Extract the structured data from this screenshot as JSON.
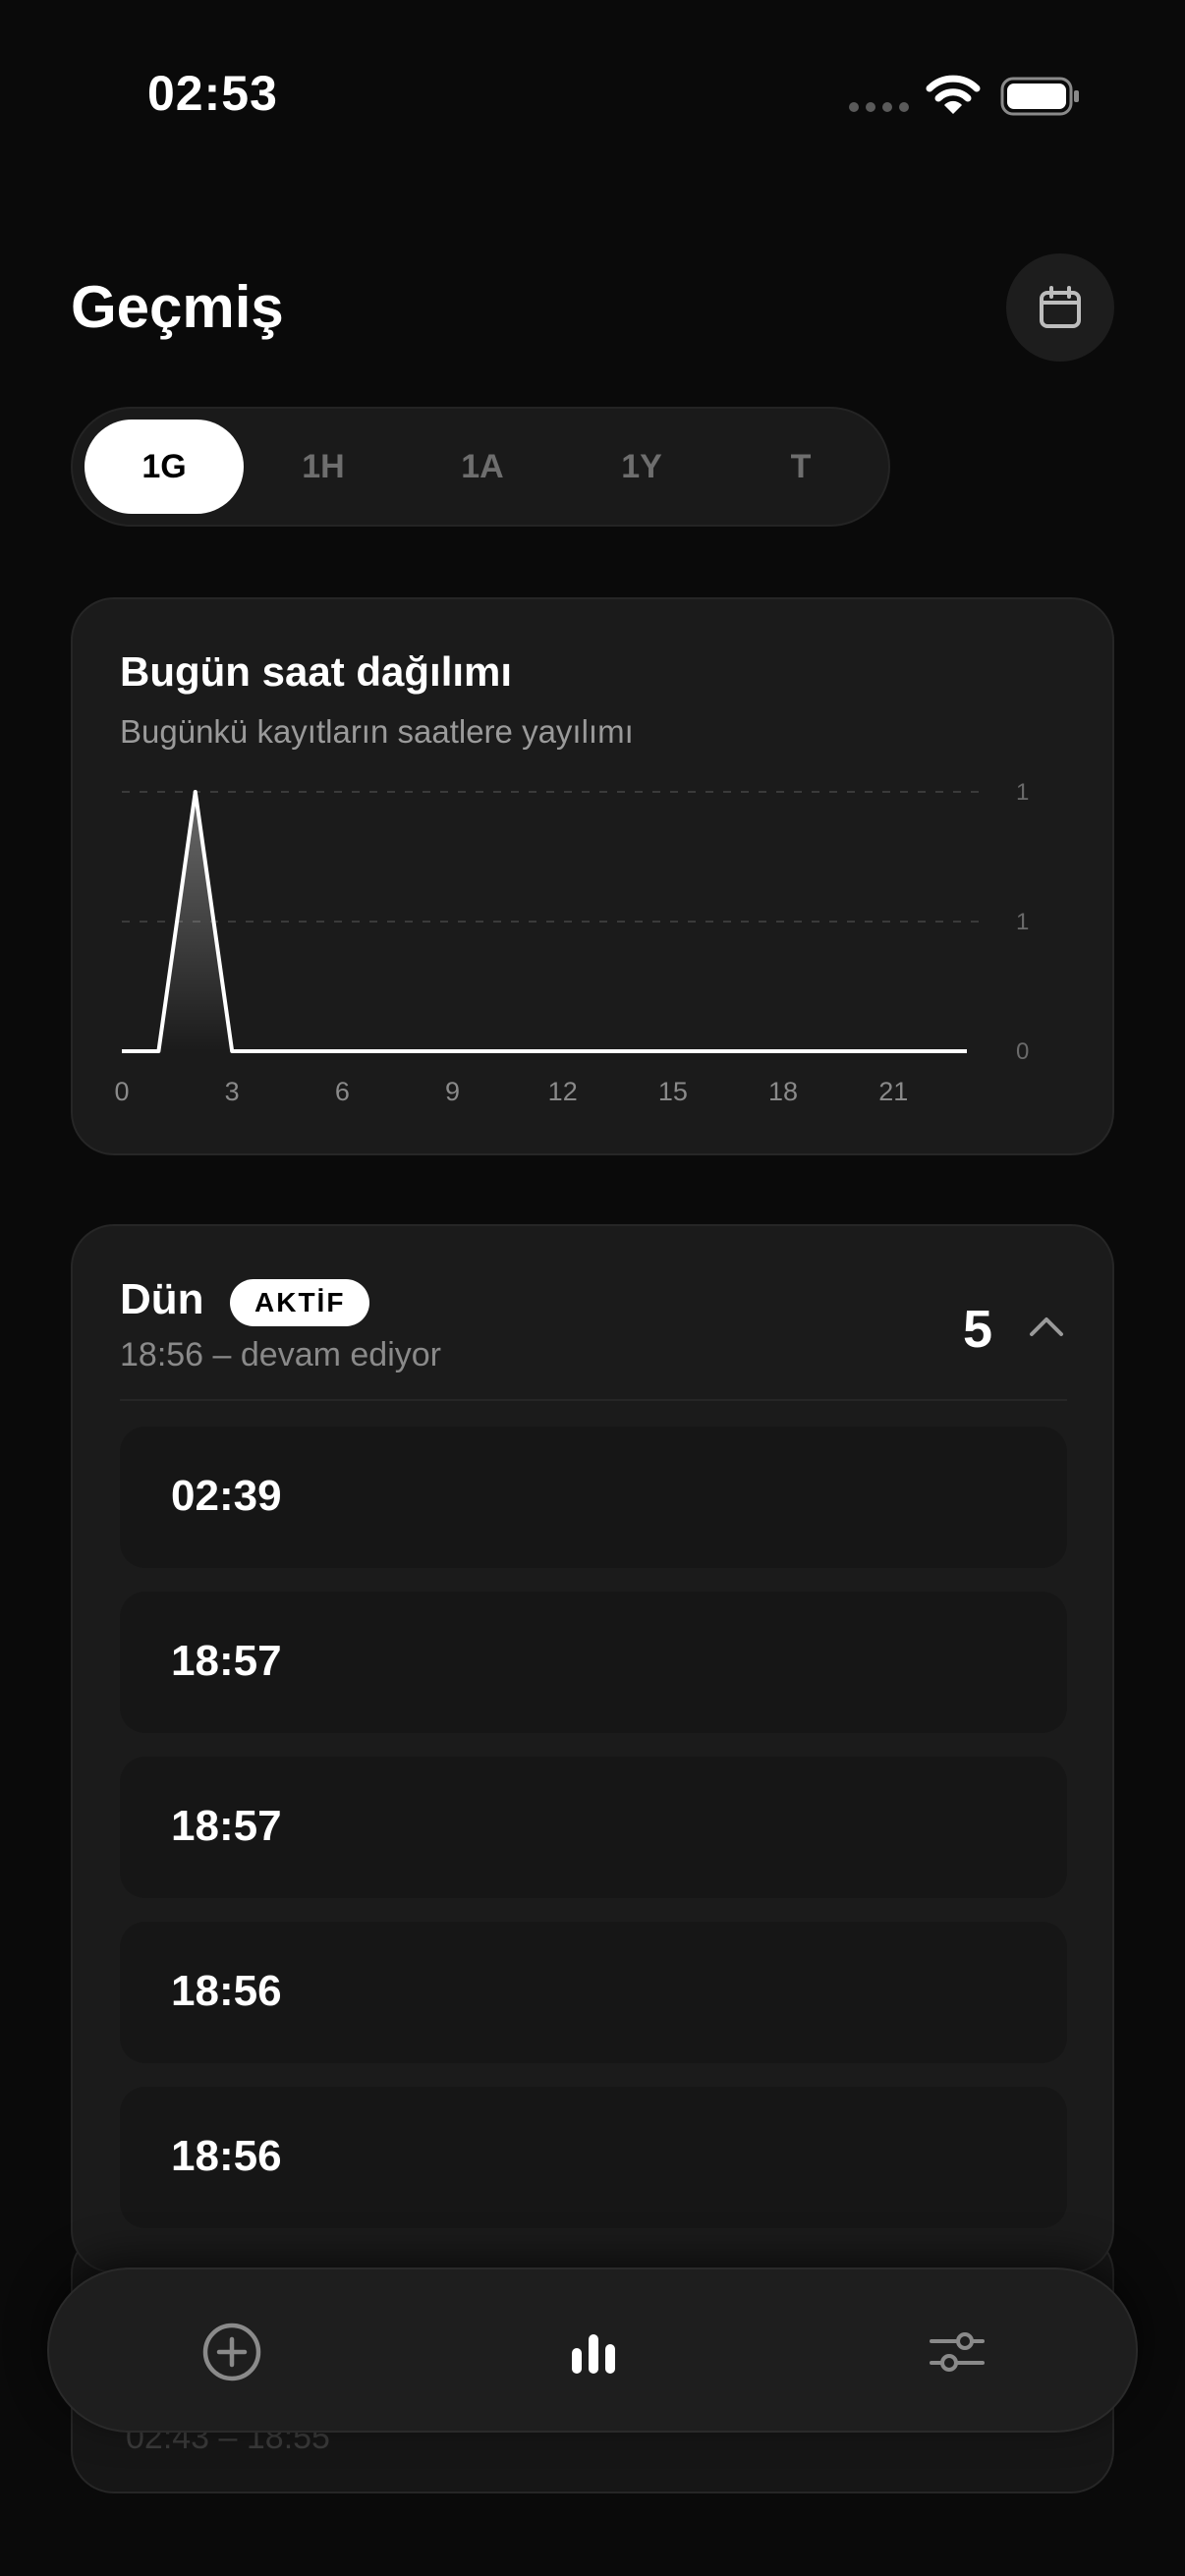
{
  "status_bar": {
    "time": "02:53"
  },
  "header": {
    "title": "Geçmiş"
  },
  "range_tabs": [
    {
      "label": "1G",
      "active": true
    },
    {
      "label": "1H",
      "active": false
    },
    {
      "label": "1A",
      "active": false
    },
    {
      "label": "1Y",
      "active": false
    },
    {
      "label": "T",
      "active": false
    }
  ],
  "chart_card": {
    "title": "Bugün saat dağılımı",
    "subtitle": "Bugünkü kayıtların saatlere yayılımı"
  },
  "chart_data": {
    "type": "line",
    "title": "Bugün saat dağılımı",
    "subtitle": "Bugünkü kayıtların saatlere yayılımı",
    "x": [
      0,
      1,
      2,
      3,
      4,
      5,
      6,
      7,
      8,
      9,
      10,
      11,
      12,
      13,
      14,
      15,
      16,
      17,
      18,
      19,
      20,
      21,
      22,
      23
    ],
    "values": [
      0,
      0,
      1,
      0,
      0,
      0,
      0,
      0,
      0,
      0,
      0,
      0,
      0,
      0,
      0,
      0,
      0,
      0,
      0,
      0,
      0,
      0,
      0,
      0
    ],
    "x_ticks": [
      "0",
      "3",
      "6",
      "9",
      "12",
      "15",
      "18",
      "21"
    ],
    "y_ticks": [
      "0",
      "1",
      "1"
    ],
    "ylim": [
      0,
      1
    ],
    "grid": true,
    "line_color": "#ffffff"
  },
  "day_group": {
    "title": "Dün",
    "badge": "AKTİF",
    "range": "18:56 – devam ediyor",
    "count": "5",
    "entries": [
      "02:39",
      "18:57",
      "18:57",
      "18:56",
      "18:56"
    ]
  },
  "next_group": {
    "range": "02:43 – 18:55"
  },
  "tab_bar": {
    "items": [
      "add-circle-icon",
      "bar-chart-icon",
      "sliders-icon"
    ]
  },
  "colors": {
    "background": "#0a0a0a",
    "card": "#1b1b1b",
    "accent": "#ffffff",
    "muted": "#8a8a8a"
  }
}
